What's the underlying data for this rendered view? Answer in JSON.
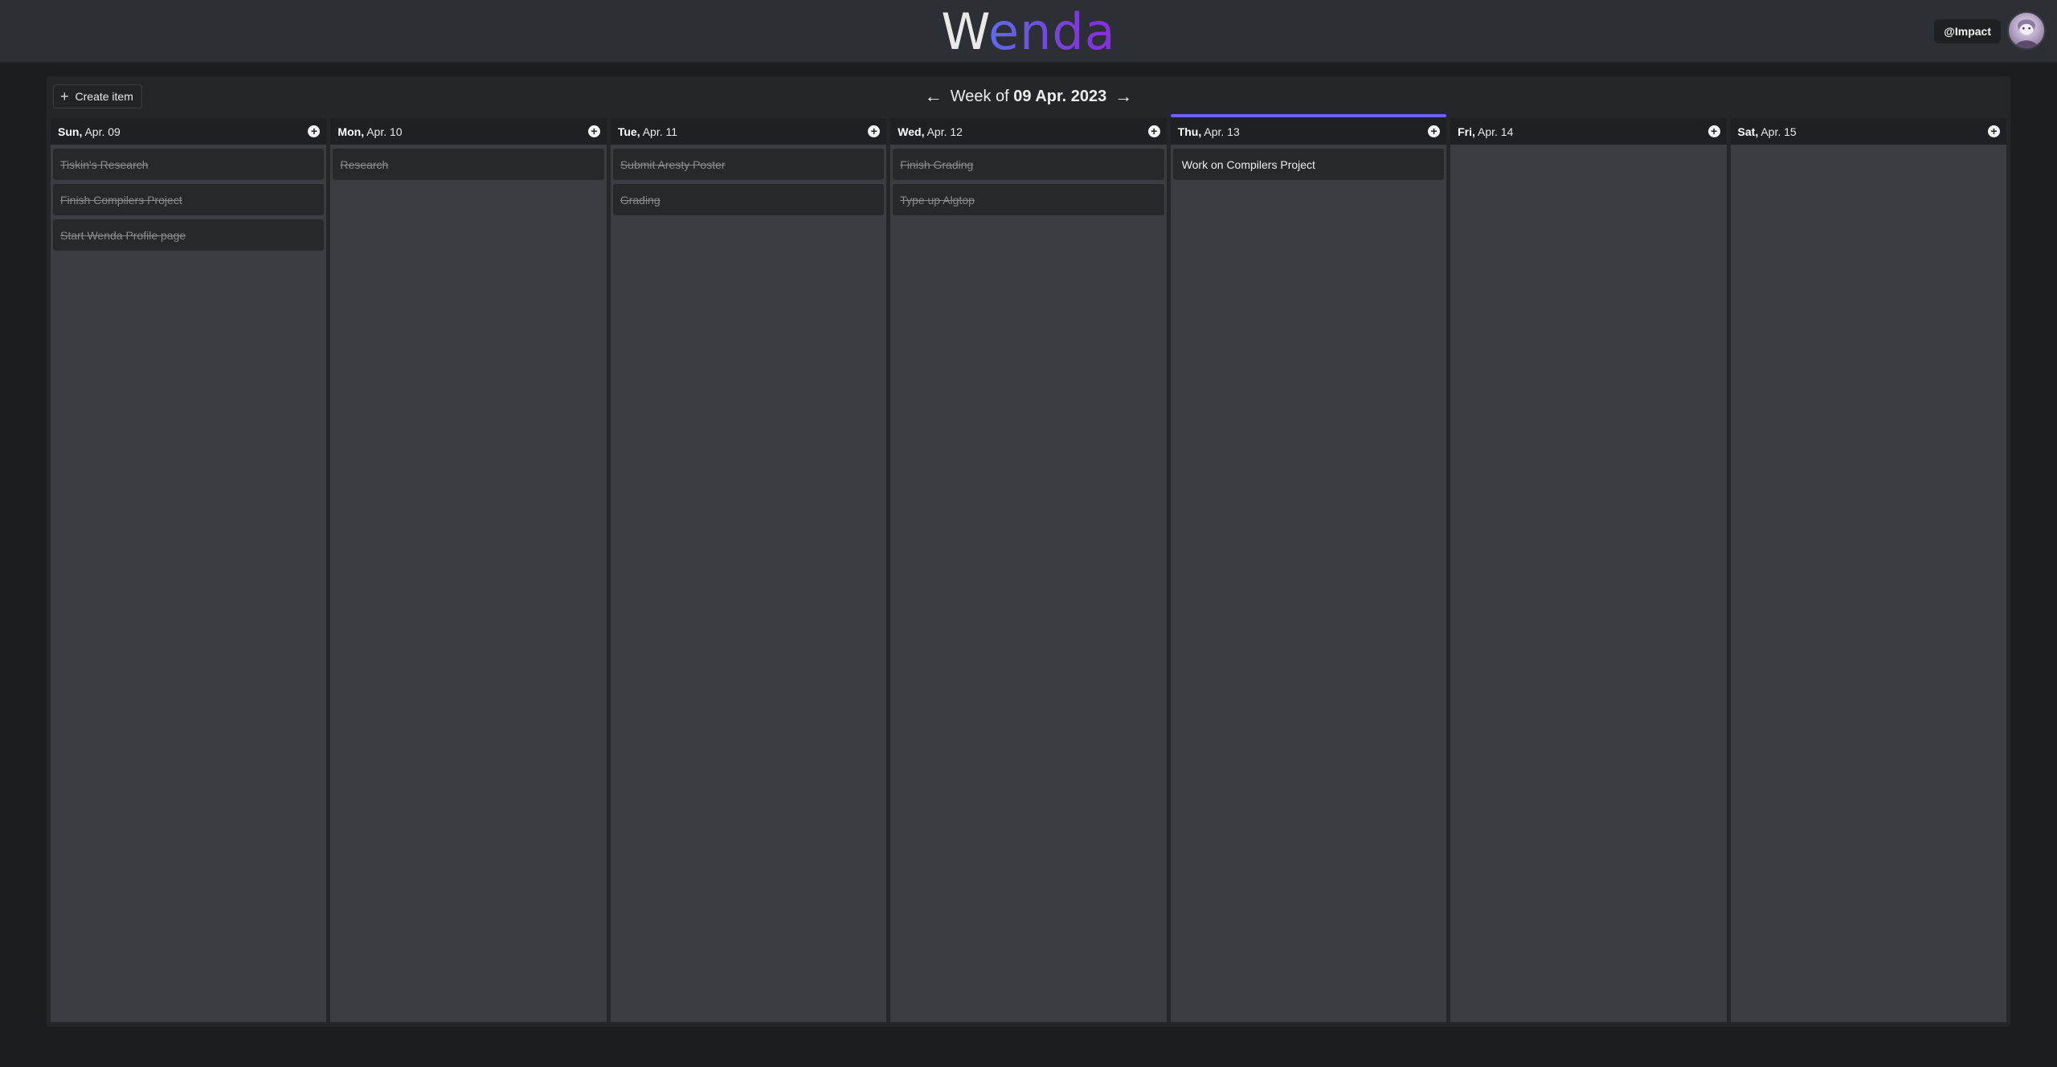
{
  "app": {
    "logo_first": "W",
    "logo_rest": "enda"
  },
  "user": {
    "handle": "@Impact"
  },
  "toolbar": {
    "create_label": "Create item",
    "create_icon": "plus-icon"
  },
  "week": {
    "prefix": "Week of",
    "date": "09 Apr. 2023",
    "prev_icon": "arrow-left-icon",
    "next_icon": "arrow-right-icon"
  },
  "accent_color": "#6b63f0",
  "days": [
    {
      "dow": "Sun,",
      "date": "Apr. 09",
      "today": false,
      "tasks": [
        {
          "title": "Tiskin's Research",
          "done": true
        },
        {
          "title": "Finish Compilers Project",
          "done": true
        },
        {
          "title": "Start Wenda Profile page",
          "done": true
        }
      ]
    },
    {
      "dow": "Mon,",
      "date": "Apr. 10",
      "today": false,
      "tasks": [
        {
          "title": "Research",
          "done": true
        }
      ]
    },
    {
      "dow": "Tue,",
      "date": "Apr. 11",
      "today": false,
      "tasks": [
        {
          "title": "Submit Aresty Poster",
          "done": true
        },
        {
          "title": "Grading",
          "done": true
        }
      ]
    },
    {
      "dow": "Wed,",
      "date": "Apr. 12",
      "today": false,
      "tasks": [
        {
          "title": "Finish Grading",
          "done": true
        },
        {
          "title": "Type up Algtop",
          "done": true
        }
      ]
    },
    {
      "dow": "Thu,",
      "date": "Apr. 13",
      "today": true,
      "tasks": [
        {
          "title": "Work on Compilers Project",
          "done": false
        }
      ]
    },
    {
      "dow": "Fri,",
      "date": "Apr. 14",
      "today": false,
      "tasks": []
    },
    {
      "dow": "Sat,",
      "date": "Apr. 15",
      "today": false,
      "tasks": []
    }
  ]
}
